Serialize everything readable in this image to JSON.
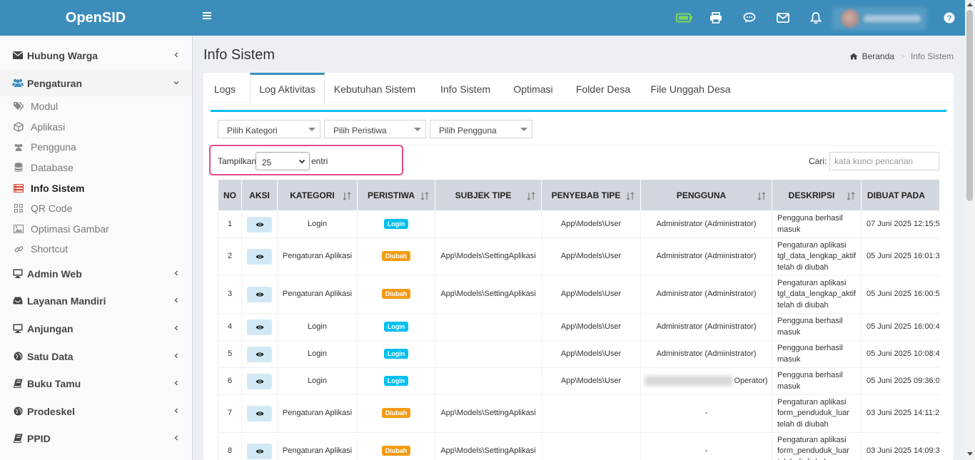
{
  "app": {
    "title": "OpenSID"
  },
  "colors": {
    "header": "#3c8dbc",
    "login_badge": "#00c0ef",
    "ubah_badge": "#f39c12",
    "tab_line": "#00c0ef",
    "highlight": "#e04c87"
  },
  "header_icons": [
    "bars-icon",
    "battery-icon",
    "printer-icon",
    "comment-icon",
    "envelope-icon",
    "bell-icon",
    "question-circle-icon"
  ],
  "sidebar": {
    "items": [
      {
        "label": "Hubung Warga",
        "icon": "envelope-icon"
      },
      {
        "label": "Pengaturan",
        "icon": "users-icon"
      },
      {
        "label": "Admin Web",
        "icon": "desktop-icon"
      },
      {
        "label": "Layanan Mandiri",
        "icon": "inbox-icon"
      },
      {
        "label": "Anjungan",
        "icon": "desktop-icon"
      },
      {
        "label": "Satu Data",
        "icon": "globe-icon"
      },
      {
        "label": "Buku Tamu",
        "icon": "book-icon"
      },
      {
        "label": "Prodeskel",
        "icon": "globe-icon"
      },
      {
        "label": "PPID",
        "icon": "book-icon"
      }
    ],
    "submenu": [
      {
        "label": "Modul",
        "icon": "tags-icon"
      },
      {
        "label": "Aplikasi",
        "icon": "cube-icon"
      },
      {
        "label": "Pengguna",
        "icon": "users-icon"
      },
      {
        "label": "Database",
        "icon": "database-icon"
      },
      {
        "label": "Info Sistem",
        "icon": "server-icon"
      },
      {
        "label": "QR Code",
        "icon": "qrcode-icon"
      },
      {
        "label": "Optimasi Gambar",
        "icon": "image-icon"
      },
      {
        "label": "Shortcut",
        "icon": "link-icon"
      }
    ]
  },
  "page": {
    "title": "Info Sistem"
  },
  "breadcrumb": {
    "home": "Beranda",
    "separator": ">",
    "current": "Info Sistem"
  },
  "tabs": [
    "Logs",
    "Log Aktivitas",
    "Kebutuhan Sistem",
    "Info Sistem",
    "Optimasi",
    "Folder Desa",
    "File Unggah Desa"
  ],
  "filters": {
    "kategori": "Pilih Kategori",
    "peristiwa": "Pilih Peristiwa",
    "pengguna": "Pilih Pengguna"
  },
  "length": {
    "label": "Tampilkan",
    "value": "25",
    "suffix": "entri"
  },
  "search": {
    "label": "Cari:",
    "placeholder": "kata kunci pencarian"
  },
  "table": {
    "headers": [
      "NO",
      "AKSI",
      "KATEGORI",
      "PERISTIWA",
      "SUBJEK TIPE",
      "PENYEBAB TIPE",
      "PENGGUNA",
      "DESKRIPSI",
      "DIBUAT PADA"
    ],
    "rows": [
      {
        "no": "1",
        "kategori": "Login",
        "peristiwa": "Login",
        "subjek": "",
        "penyebab": "App\\Models\\User",
        "pengguna": "Administrator (Administrator)",
        "deskripsi": "Pengguna berhasil masuk",
        "dibuat": "07 Juni 2025 12:15:5"
      },
      {
        "no": "2",
        "kategori": "Pengaturan Aplikasi",
        "peristiwa": "Diubah",
        "subjek": "App\\Models\\SettingAplikasi",
        "penyebab": "App\\Models\\User",
        "pengguna": "Administrator (Administrator)",
        "deskripsi": "Pengaturan aplikasi tgl_data_lengkap_aktif telah di diubah",
        "dibuat": "05 Juni 2025 16:01:3"
      },
      {
        "no": "3",
        "kategori": "Pengaturan Aplikasi",
        "peristiwa": "Diubah",
        "subjek": "App\\Models\\SettingAplikasi",
        "penyebab": "App\\Models\\User",
        "pengguna": "Administrator (Administrator)",
        "deskripsi": "Pengaturan aplikasi tgl_data_lengkap_aktif telah di diubah",
        "dibuat": "05 Juni 2025 16:00:5"
      },
      {
        "no": "4",
        "kategori": "Login",
        "peristiwa": "Login",
        "subjek": "",
        "penyebab": "App\\Models\\User",
        "pengguna": "Administrator (Administrator)",
        "deskripsi": "Pengguna berhasil masuk",
        "dibuat": "05 Juni 2025 16:00:4"
      },
      {
        "no": "5",
        "kategori": "Login",
        "peristiwa": "Login",
        "subjek": "",
        "penyebab": "App\\Models\\User",
        "pengguna": "Administrator (Administrator)",
        "deskripsi": "Pengguna berhasil masuk",
        "dibuat": "05 Juni 2025 10:08:4"
      },
      {
        "no": "6",
        "kategori": "Login",
        "peristiwa": "Login",
        "subjek": "",
        "penyebab": "App\\Models\\User",
        "pengguna": "Operator)",
        "pengguna_blurred": true,
        "deskripsi": "Pengguna berhasil masuk",
        "dibuat": "05 Juni 2025 09:36:0"
      },
      {
        "no": "7",
        "kategori": "Pengaturan Aplikasi",
        "peristiwa": "Diubah",
        "subjek": "App\\Models\\SettingAplikasi",
        "penyebab": "",
        "pengguna": "-",
        "deskripsi": "Pengaturan aplikasi form_penduduk_luar telah di diubah",
        "dibuat": "03 Juni 2025 14:11:2"
      },
      {
        "no": "8",
        "kategori": "Pengaturan Aplikasi",
        "peristiwa": "Diubah",
        "subjek": "App\\Models\\SettingAplikasi",
        "penyebab": "",
        "pengguna": "-",
        "deskripsi": "Pengaturan aplikasi form_penduduk_luar telah di diubah",
        "dibuat": "03 Juni 2025 14:09:3"
      }
    ]
  }
}
